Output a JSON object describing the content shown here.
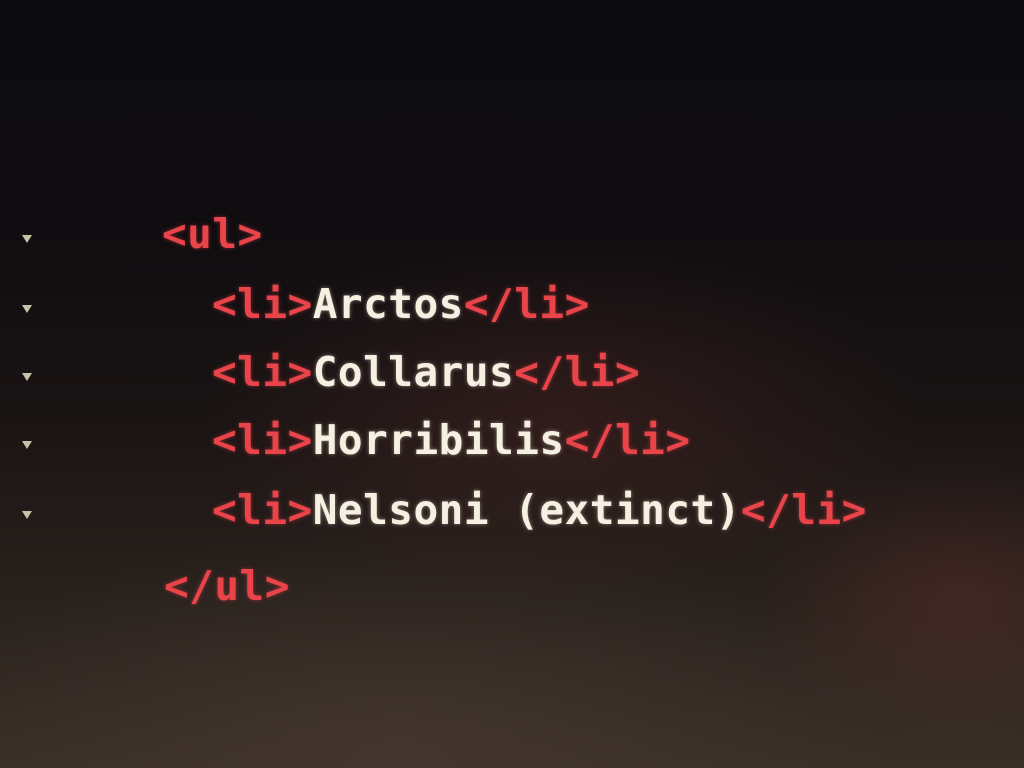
{
  "editor": {
    "lines": [
      {
        "open": "<ul>",
        "content": "",
        "close": ""
      },
      {
        "open": "<li>",
        "content": "Arctos",
        "close": "</li>"
      },
      {
        "open": "<li>",
        "content": "Collarus",
        "close": "</li>"
      },
      {
        "open": "<li>",
        "content": "Horribilis",
        "close": "</li>"
      },
      {
        "open": "<li>",
        "content": "Nelsoni (extinct)",
        "close": "</li>"
      },
      {
        "open": "</ul>",
        "content": "",
        "close": ""
      }
    ],
    "fold_icon": "fold-triangle-icon"
  },
  "colors": {
    "tag": "#e8444a",
    "text": "#f5f0e2",
    "gutter_icon": "#c8c2a8"
  }
}
